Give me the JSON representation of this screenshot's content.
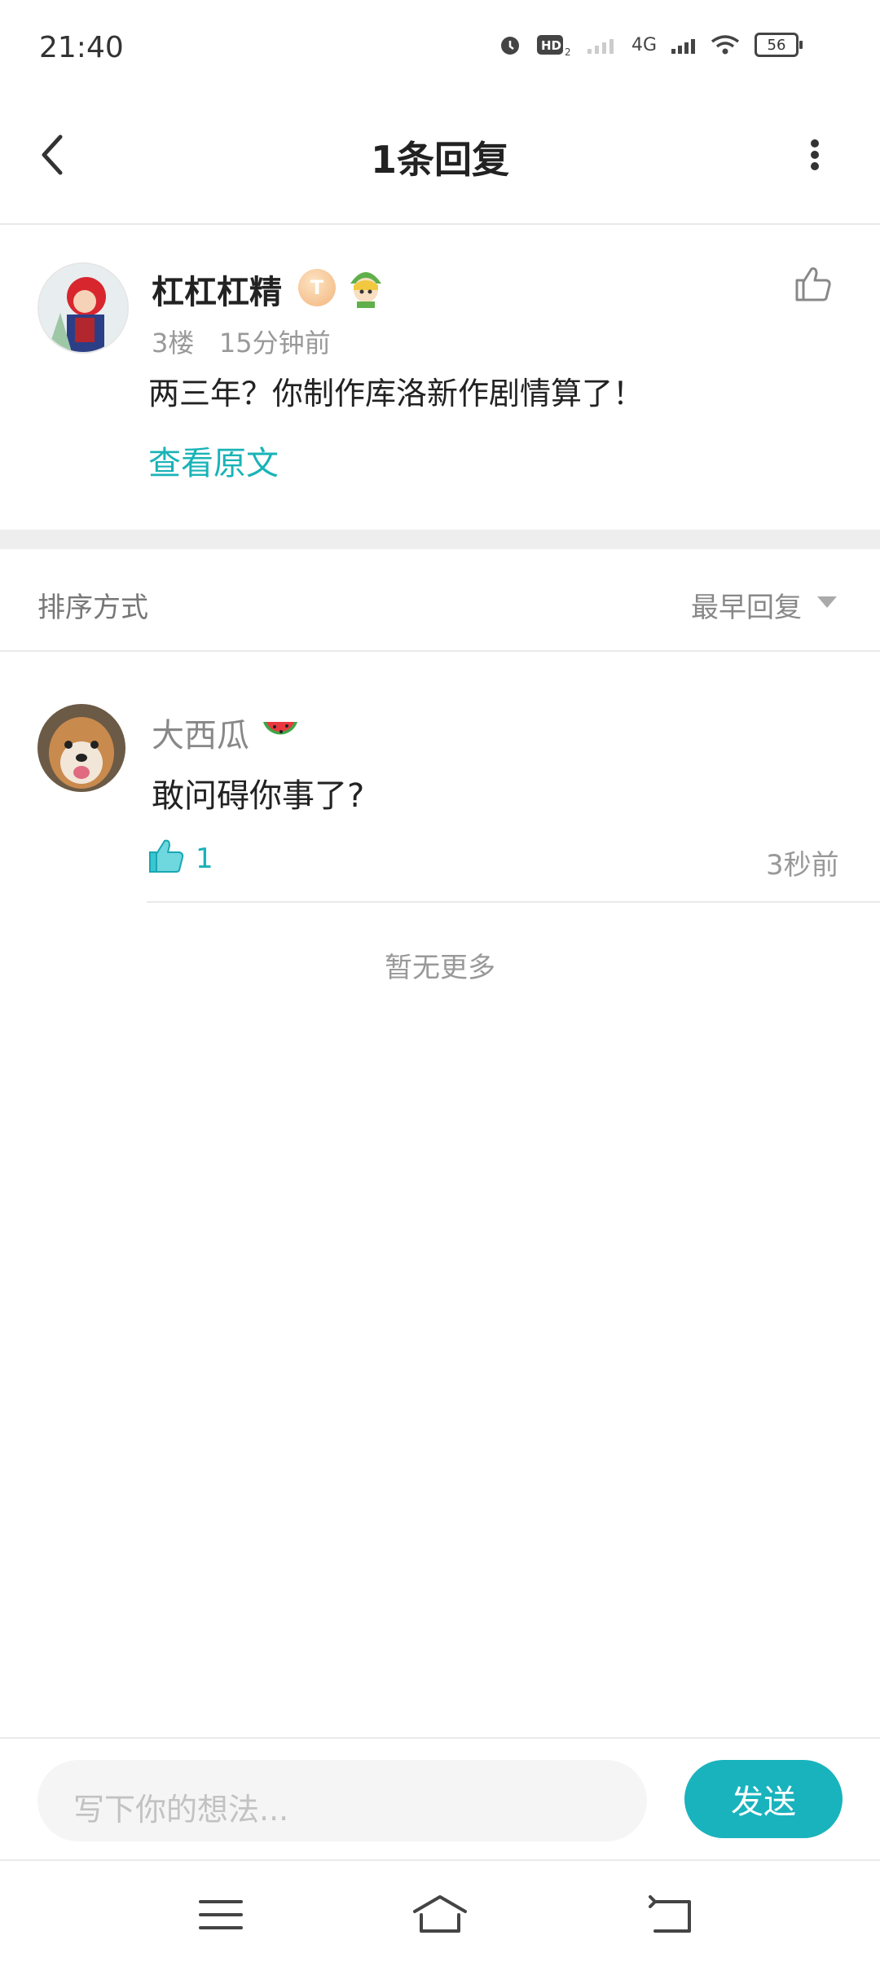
{
  "status_bar": {
    "time": "21:40",
    "network": "4G",
    "battery": "56"
  },
  "header": {
    "title": "1条回复"
  },
  "original_comment": {
    "username": "杠杠杠精",
    "badge_letter": "T",
    "floor": "3楼",
    "time": "15分钟前",
    "content": "两三年？你制作库洛新作剧情算了！",
    "view_original": "查看原文"
  },
  "sort": {
    "label": "排序方式",
    "value": "最早回复"
  },
  "reply": {
    "username": "大西瓜",
    "content": "敢问碍你事了?",
    "like_count": "1",
    "time": "3秒前"
  },
  "list_end": "暂无更多",
  "composer": {
    "placeholder": "写下你的想法...",
    "send_label": "发送"
  },
  "colors": {
    "accent": "#19b3bd",
    "text": "#222222",
    "muted": "#999999"
  }
}
